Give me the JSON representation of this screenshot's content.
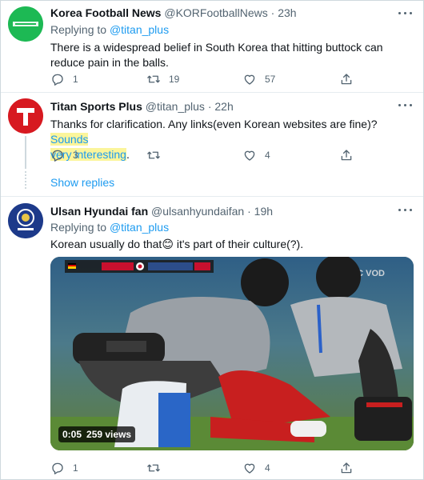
{
  "tweets": [
    {
      "name": "Korea Football News",
      "handle": "@KORFootballNews",
      "time": "23h",
      "replying_to_prefix": "Replying to",
      "replying_to": "@titan_plus",
      "text_lines": [
        "There is a widespread belief in South Korea that hitting buttock can",
        "reduce pain in the balls."
      ],
      "replies": "1",
      "retweets": "19",
      "likes": "57",
      "avatar_icon": "korea-football-news-logo",
      "avatar_color": "#1db954"
    },
    {
      "name": "Titan Sports Plus",
      "handle": "@titan_plus",
      "time": "22h",
      "text_plain": "Thanks for clarification. Any links(even Korean websites are fine)? ",
      "text_highlight_1": "Sounds",
      "text_highlight_2": "very interesting",
      "text_tail": ".",
      "replies": "3",
      "retweets": "",
      "likes": "4",
      "avatar_icon": "titan-sports-logo",
      "avatar_color": "#d71920"
    },
    {
      "name": "Ulsan Hyundai fan",
      "handle": "@ulsanhyundaifan",
      "time": "19h",
      "replying_to_prefix": "Replying to",
      "replying_to": "@titan_plus",
      "text_before": "Korean usually do that",
      "emoji": "😊",
      "text_after": " it's part of their culture(?).",
      "replies": "1",
      "retweets": "",
      "likes": "4",
      "avatar_icon": "k-league-logo",
      "avatar_color": "#1d3a8a"
    }
  ],
  "show_replies": "Show replies",
  "video": {
    "duration": "0:05",
    "views": "259 views",
    "broadcaster": "MBC VOD",
    "scoreboard": "독일 0 - 0 대한민국 · 후반 45:00 +0:29 +6"
  },
  "icons": {
    "reply": "reply-icon",
    "retweet": "retweet-icon",
    "like": "heart-icon",
    "share": "share-icon",
    "more": "more-icon"
  }
}
